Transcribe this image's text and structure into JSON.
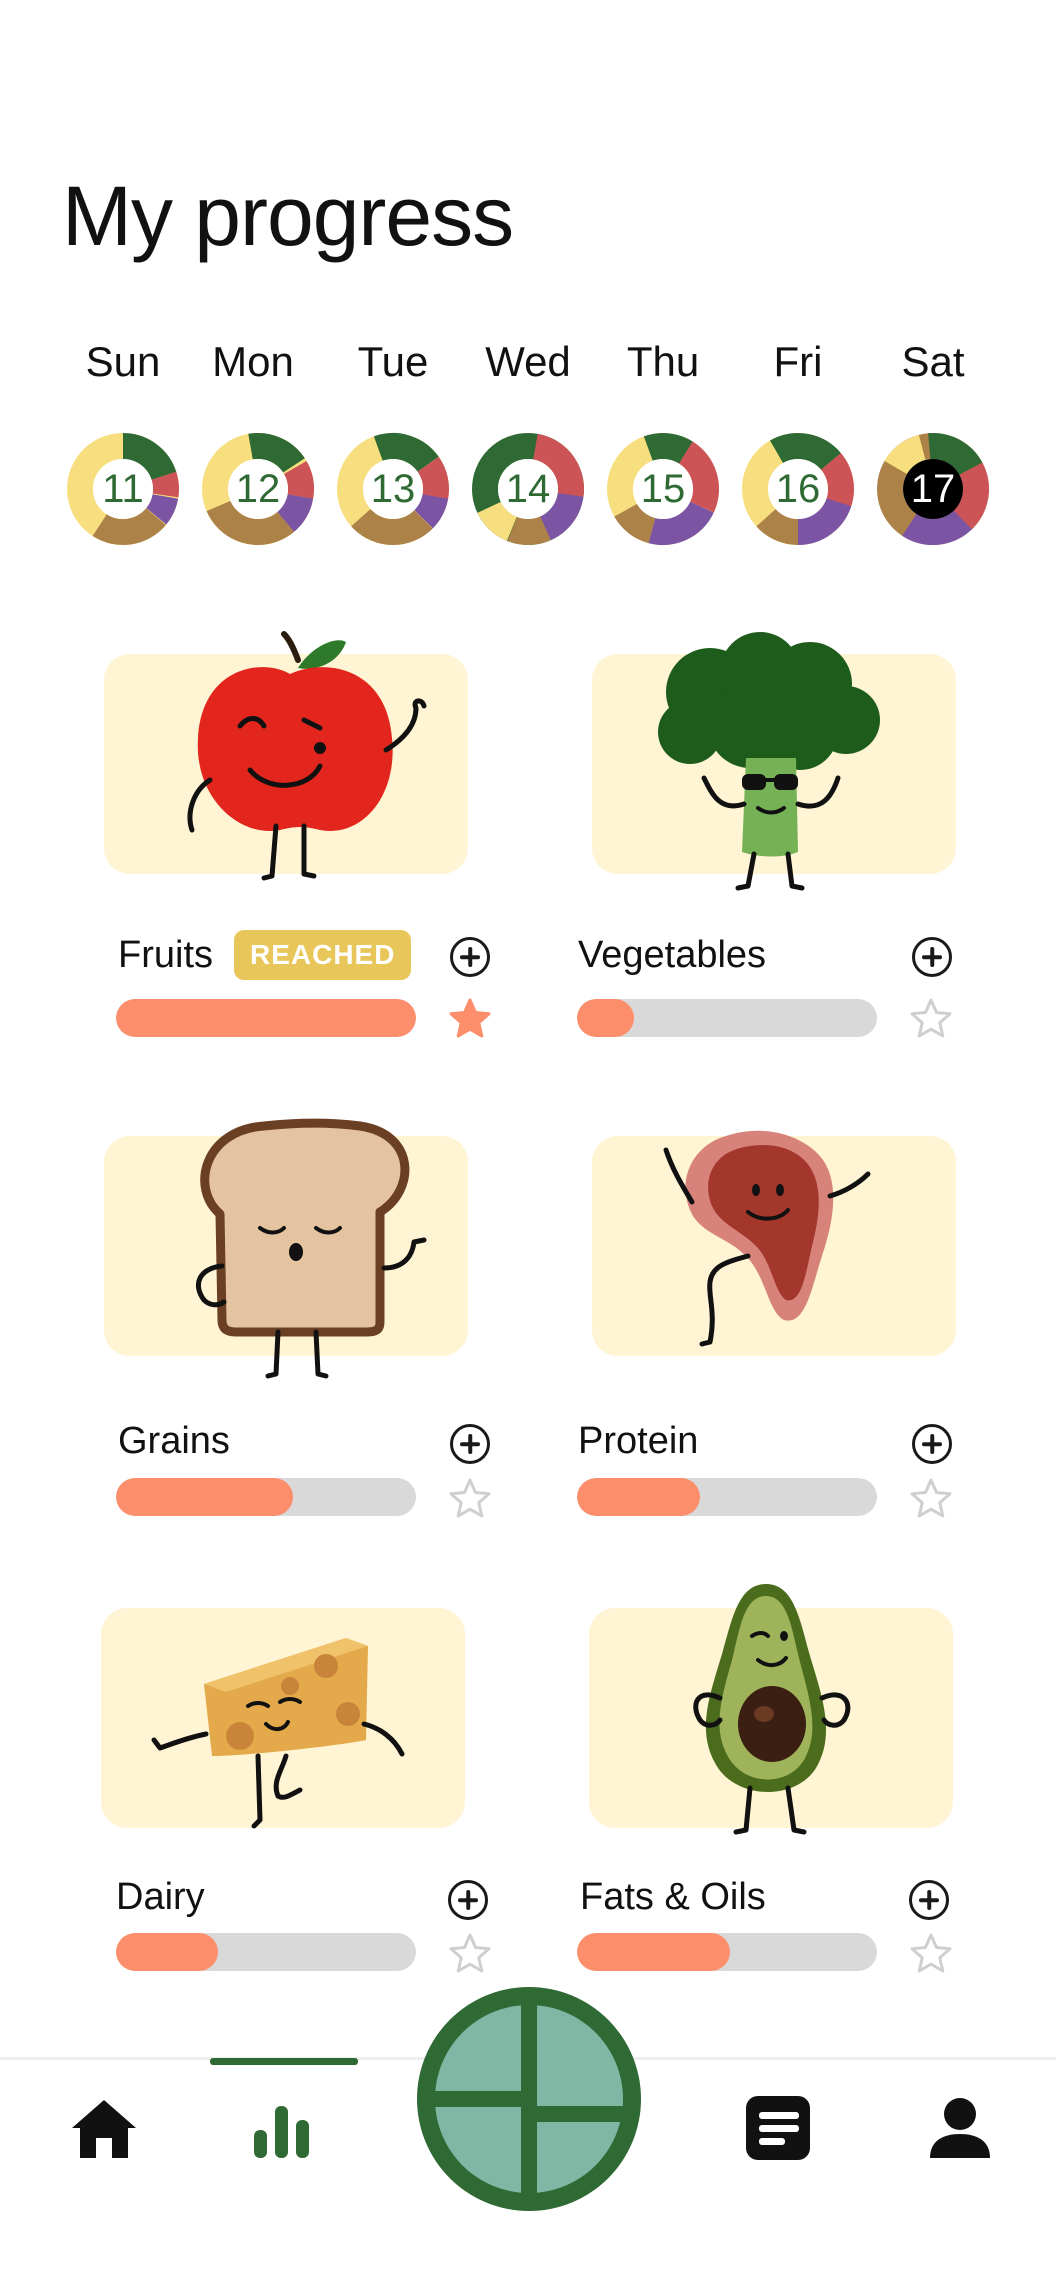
{
  "page": {
    "title": "My progress"
  },
  "week": {
    "days": [
      {
        "label": "Sun",
        "date": "11"
      },
      {
        "label": "Mon",
        "date": "12"
      },
      {
        "label": "Tue",
        "date": "13"
      },
      {
        "label": "Wed",
        "date": "14"
      },
      {
        "label": "Thu",
        "date": "15"
      },
      {
        "label": "Fri",
        "date": "16"
      },
      {
        "label": "Sat",
        "date": "17",
        "selected": true
      }
    ],
    "ring_colors": {
      "vegetables": "#2f6a34",
      "protein": "#cc5457",
      "fats": "#7b55a4",
      "grains": "#ad8248",
      "fruits": "#f7df7f"
    }
  },
  "categories": [
    {
      "label": "Fruits",
      "badge": "REACHED",
      "progress": 1.0,
      "starred": true,
      "mascot": "apple"
    },
    {
      "label": "Vegetables",
      "progress": 0.19,
      "starred": false,
      "mascot": "broccoli"
    },
    {
      "label": "Grains",
      "progress": 0.59,
      "starred": false,
      "mascot": "bread"
    },
    {
      "label": "Protein",
      "progress": 0.41,
      "starred": false,
      "mascot": "steak"
    },
    {
      "label": "Dairy",
      "progress": 0.34,
      "starred": false,
      "mascot": "cheese"
    },
    {
      "label": "Fats & Oils",
      "progress": 0.51,
      "starred": false,
      "mascot": "avocado"
    }
  ],
  "nav": {
    "items": [
      {
        "name": "home-icon"
      },
      {
        "name": "progress-chart-icon",
        "active": true
      },
      {
        "name": "log-meal-plate-icon"
      },
      {
        "name": "journal-icon"
      },
      {
        "name": "profile-icon"
      }
    ],
    "accent": "#2f6a34",
    "fab_fill": "#7fb7a5"
  },
  "colors": {
    "bar_fill": "#fd8e6c",
    "bar_track": "#d9d9d9",
    "card_bg": "#fff4d4",
    "badge_bg": "#e8c65a",
    "star_active": "#fd8e6c",
    "star_inactive": "#cfcfcf"
  }
}
